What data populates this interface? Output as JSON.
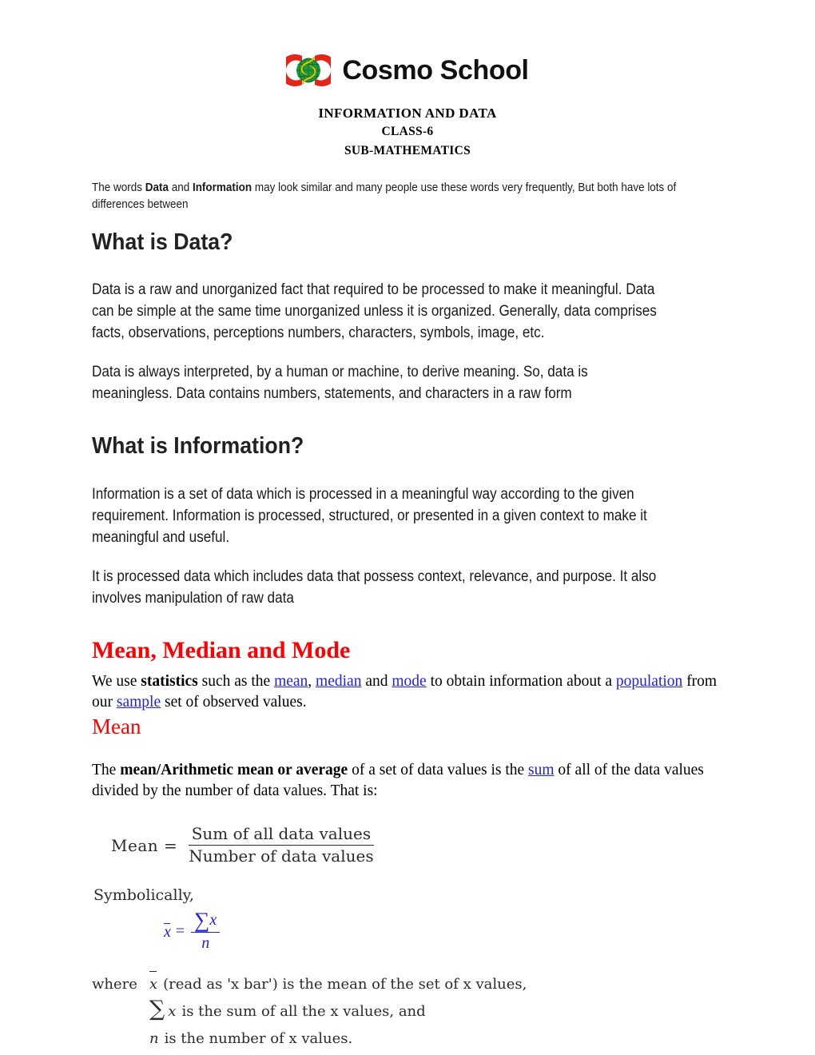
{
  "header": {
    "logo_icon": "cosmo-school-globe-logo",
    "logo_colors": {
      "arc_red": "#e1261c",
      "globe_green": "#1e9b3c",
      "swoosh_yellow": "#f5d800"
    },
    "wordmark": "Cosmo School"
  },
  "titles": {
    "line1": "INFORMATION AND DATA",
    "line2": "CLASS-6",
    "line3": "SUB-MATHEMATICS"
  },
  "intro": {
    "part1": "The words ",
    "bold1": "Data",
    "part2": " and ",
    "bold2": "Information",
    "part3": " may look similar and many people use these words very frequently, But both have lots of differences between"
  },
  "data_section": {
    "heading": "What is Data?",
    "paragraph1": "Data is a raw and unorganized fact that required to be processed to make it meaningful. Data can be simple at the same time unorganized unless it is organized. Generally, data comprises facts, observations, perceptions numbers, characters, symbols, image, etc.",
    "paragraph2": "Data is always interpreted, by a human or machine, to derive meaning. So, data is meaningless. Data contains numbers, statements, and characters in a raw form"
  },
  "information_section": {
    "heading": "What is Information?",
    "paragraph1": "Information is a set of data which is processed in a meaningful way according to the given requirement. Information is processed, structured, or presented in a given context to make it meaningful and useful.",
    "paragraph2": "It is processed data which includes data that possess context, relevance, and purpose. It also involves manipulation of raw data"
  },
  "stats_section": {
    "heading": "Mean, Median and Mode",
    "intro": {
      "t1": "We use ",
      "b1": "statistics",
      "t2": " such as the ",
      "link_mean": "mean",
      "t3": ", ",
      "link_median": "median",
      "t4": " and ",
      "link_mode": "mode",
      "t5": " to obtain information about a ",
      "link_population": "population",
      "t6": " from our ",
      "link_sample": "sample",
      "t7": " set of observed values."
    },
    "subheading": "Mean",
    "mean_paragraph": {
      "t1": "The ",
      "b1": "mean/Arithmetic mean or average",
      "t2": " of a set of data values is the ",
      "link_sum": "sum",
      "t3": " of all of the data values divided by the number of data values.  That is:"
    }
  },
  "formula_word": {
    "lhs": "Mean =",
    "numerator": "Sum of all data values",
    "denominator": "Number of data values"
  },
  "formula_symbolic": {
    "label": "Symbolically,",
    "lhs": "x",
    "equals": "=",
    "sigma": "∑",
    "numerator_var": "x",
    "denominator": "n"
  },
  "where_block": {
    "line1": {
      "label": "where",
      "sym": "x",
      "text": "(read as 'x bar') is the mean of the set of x values,"
    },
    "line2": {
      "sigma": "∑",
      "sym": "x",
      "text": "is the sum of all the x  values, and"
    },
    "line3": {
      "sym": "n",
      "text": "is the number of x values."
    }
  }
}
